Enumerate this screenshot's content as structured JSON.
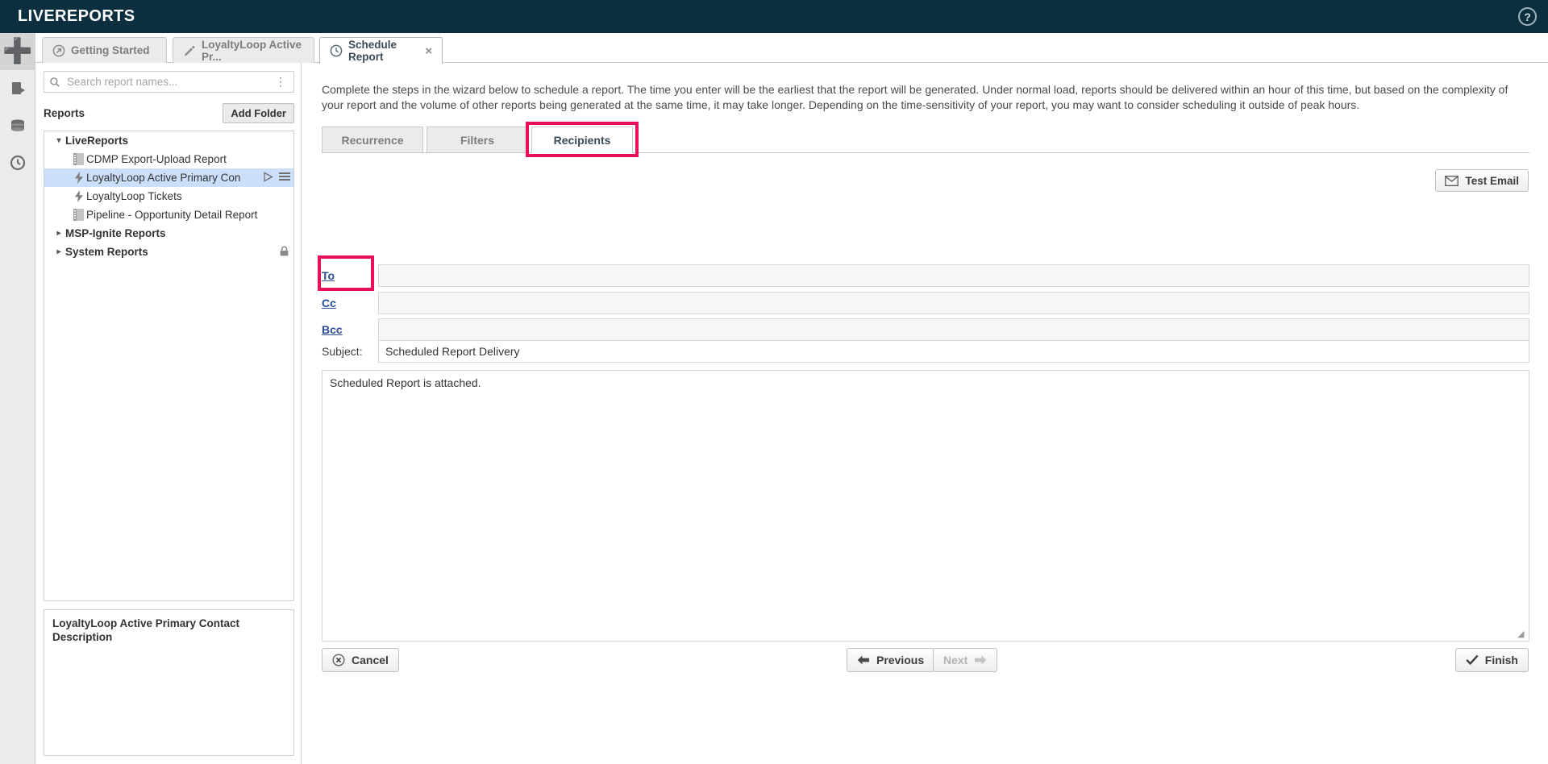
{
  "app": {
    "brand": "LIVEREPORTS",
    "help_icon": "help-circle-icon"
  },
  "rail": {
    "items": [
      {
        "name": "add",
        "icon": "plus-icon",
        "glyph": "✚"
      },
      {
        "name": "reports",
        "icon": "page-icon",
        "glyph": "▧"
      },
      {
        "name": "datasets",
        "icon": "database-icon",
        "glyph": "☰"
      },
      {
        "name": "history",
        "icon": "clock-icon",
        "glyph": "◴"
      }
    ]
  },
  "tabs": [
    {
      "label": "Getting Started",
      "icon": "arrow-circle-icon",
      "active": false,
      "closable": false
    },
    {
      "label": "LoyaltyLoop Active Pr...",
      "icon": "pencil-icon",
      "active": false,
      "closable": false
    },
    {
      "label": "Schedule Report",
      "icon": "clock-icon",
      "active": true,
      "closable": true,
      "close_glyph": "×"
    }
  ],
  "sidebar": {
    "search": {
      "placeholder": "Search report names...",
      "value": "",
      "icon": "search-icon",
      "menu_icon": "kebab-menu-icon"
    },
    "reports_label": "Reports",
    "add_folder_label": "Add Folder",
    "tree": [
      {
        "label": "LiveReports",
        "type": "folder",
        "expanded": true,
        "caret": "▾",
        "indent": 0,
        "selected": false,
        "locked": false
      },
      {
        "label": "CDMP Export-Upload Report",
        "type": "report",
        "icon": "report-icon",
        "indent": 1,
        "selected": false,
        "locked": false
      },
      {
        "label": "LoyaltyLoop Active Primary Con",
        "type": "livereport",
        "icon": "lightning-icon",
        "indent": 1,
        "selected": true,
        "locked": false,
        "actions": [
          "run-icon",
          "menu-icon"
        ]
      },
      {
        "label": "LoyaltyLoop Tickets",
        "type": "livereport",
        "icon": "lightning-icon",
        "indent": 1,
        "selected": false,
        "locked": false
      },
      {
        "label": "Pipeline - Opportunity Detail Report",
        "type": "report",
        "icon": "report-icon",
        "indent": 1,
        "selected": false,
        "locked": false
      },
      {
        "label": "MSP-Ignite Reports",
        "type": "folder",
        "expanded": false,
        "caret": "▸",
        "indent": 0,
        "selected": false,
        "locked": false
      },
      {
        "label": "System Reports",
        "type": "folder",
        "expanded": false,
        "caret": "▸",
        "indent": 0,
        "selected": false,
        "locked": true
      }
    ],
    "description": {
      "title": "LoyaltyLoop Active Primary Contact Description",
      "body": ""
    }
  },
  "main": {
    "intro": "Complete the steps in the wizard below to schedule a report. The time you enter will be the earliest that the report will be generated. Under normal load, reports should be delivered within an hour of this time, but based on the complexity of your report and the volume of other reports being generated at the same time, it may take longer. Depending on the time-sensitivity of your report, you may want to consider scheduling it outside of peak hours.",
    "wizard_tabs": [
      {
        "label": "Recurrence",
        "active": false
      },
      {
        "label": "Filters",
        "active": false
      },
      {
        "label": "Recipients",
        "active": true,
        "highlighted": true
      }
    ],
    "test_email": {
      "label": "Test Email",
      "icon": "envelope-icon"
    },
    "recipients": {
      "to": {
        "label": "To",
        "value": "",
        "highlighted": true
      },
      "cc": {
        "label": "Cc",
        "value": ""
      },
      "bcc": {
        "label": "Bcc",
        "value": ""
      },
      "subject": {
        "label": "Subject:",
        "value": "Scheduled Report Delivery"
      },
      "body": {
        "value": "Scheduled Report is attached."
      }
    },
    "footer": {
      "cancel": {
        "label": "Cancel",
        "icon": "cancel-circle-icon",
        "disabled": false
      },
      "previous": {
        "label": "Previous",
        "icon": "arrow-left-icon",
        "disabled": false
      },
      "next": {
        "label": "Next",
        "icon": "arrow-right-icon",
        "disabled": true
      },
      "finish": {
        "label": "Finish",
        "icon": "checkmark-icon",
        "disabled": false
      }
    }
  },
  "colors": {
    "topbar": "#0b2f3f",
    "highlight": "#e8105a",
    "link": "#2a4d8f",
    "selected_row": "#ccdffa"
  }
}
